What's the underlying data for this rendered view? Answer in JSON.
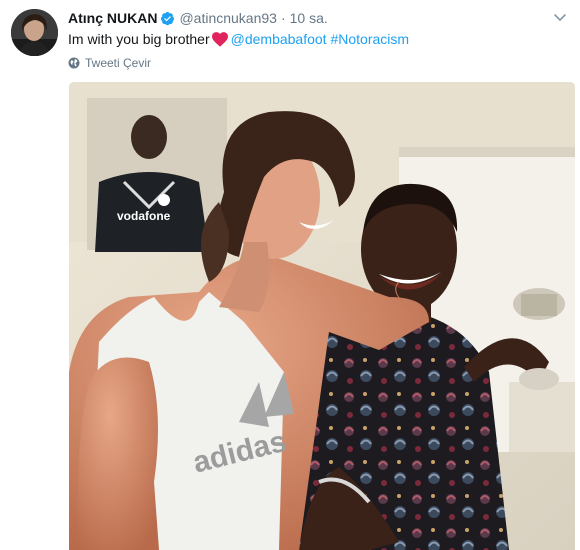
{
  "tweet": {
    "author": {
      "name": "Atınç NUKAN",
      "handle": "@atincnukan93",
      "verified_icon": "verified-badge-icon"
    },
    "separator": "·",
    "time": "10 sa.",
    "text": {
      "plain": "Im with you big brother",
      "emoji": "red-heart",
      "mention": "@dembabafoot",
      "hashtag": "#Notoracism"
    },
    "translate_label": "Tweeti Çevir",
    "photo": {
      "shirt_text": "adidas",
      "poster_sponsor": "vodafone"
    },
    "colors": {
      "link": "#1da1f2",
      "secondary": "#657786",
      "heart": "#e0245e",
      "verified": "#1da1f2"
    }
  }
}
